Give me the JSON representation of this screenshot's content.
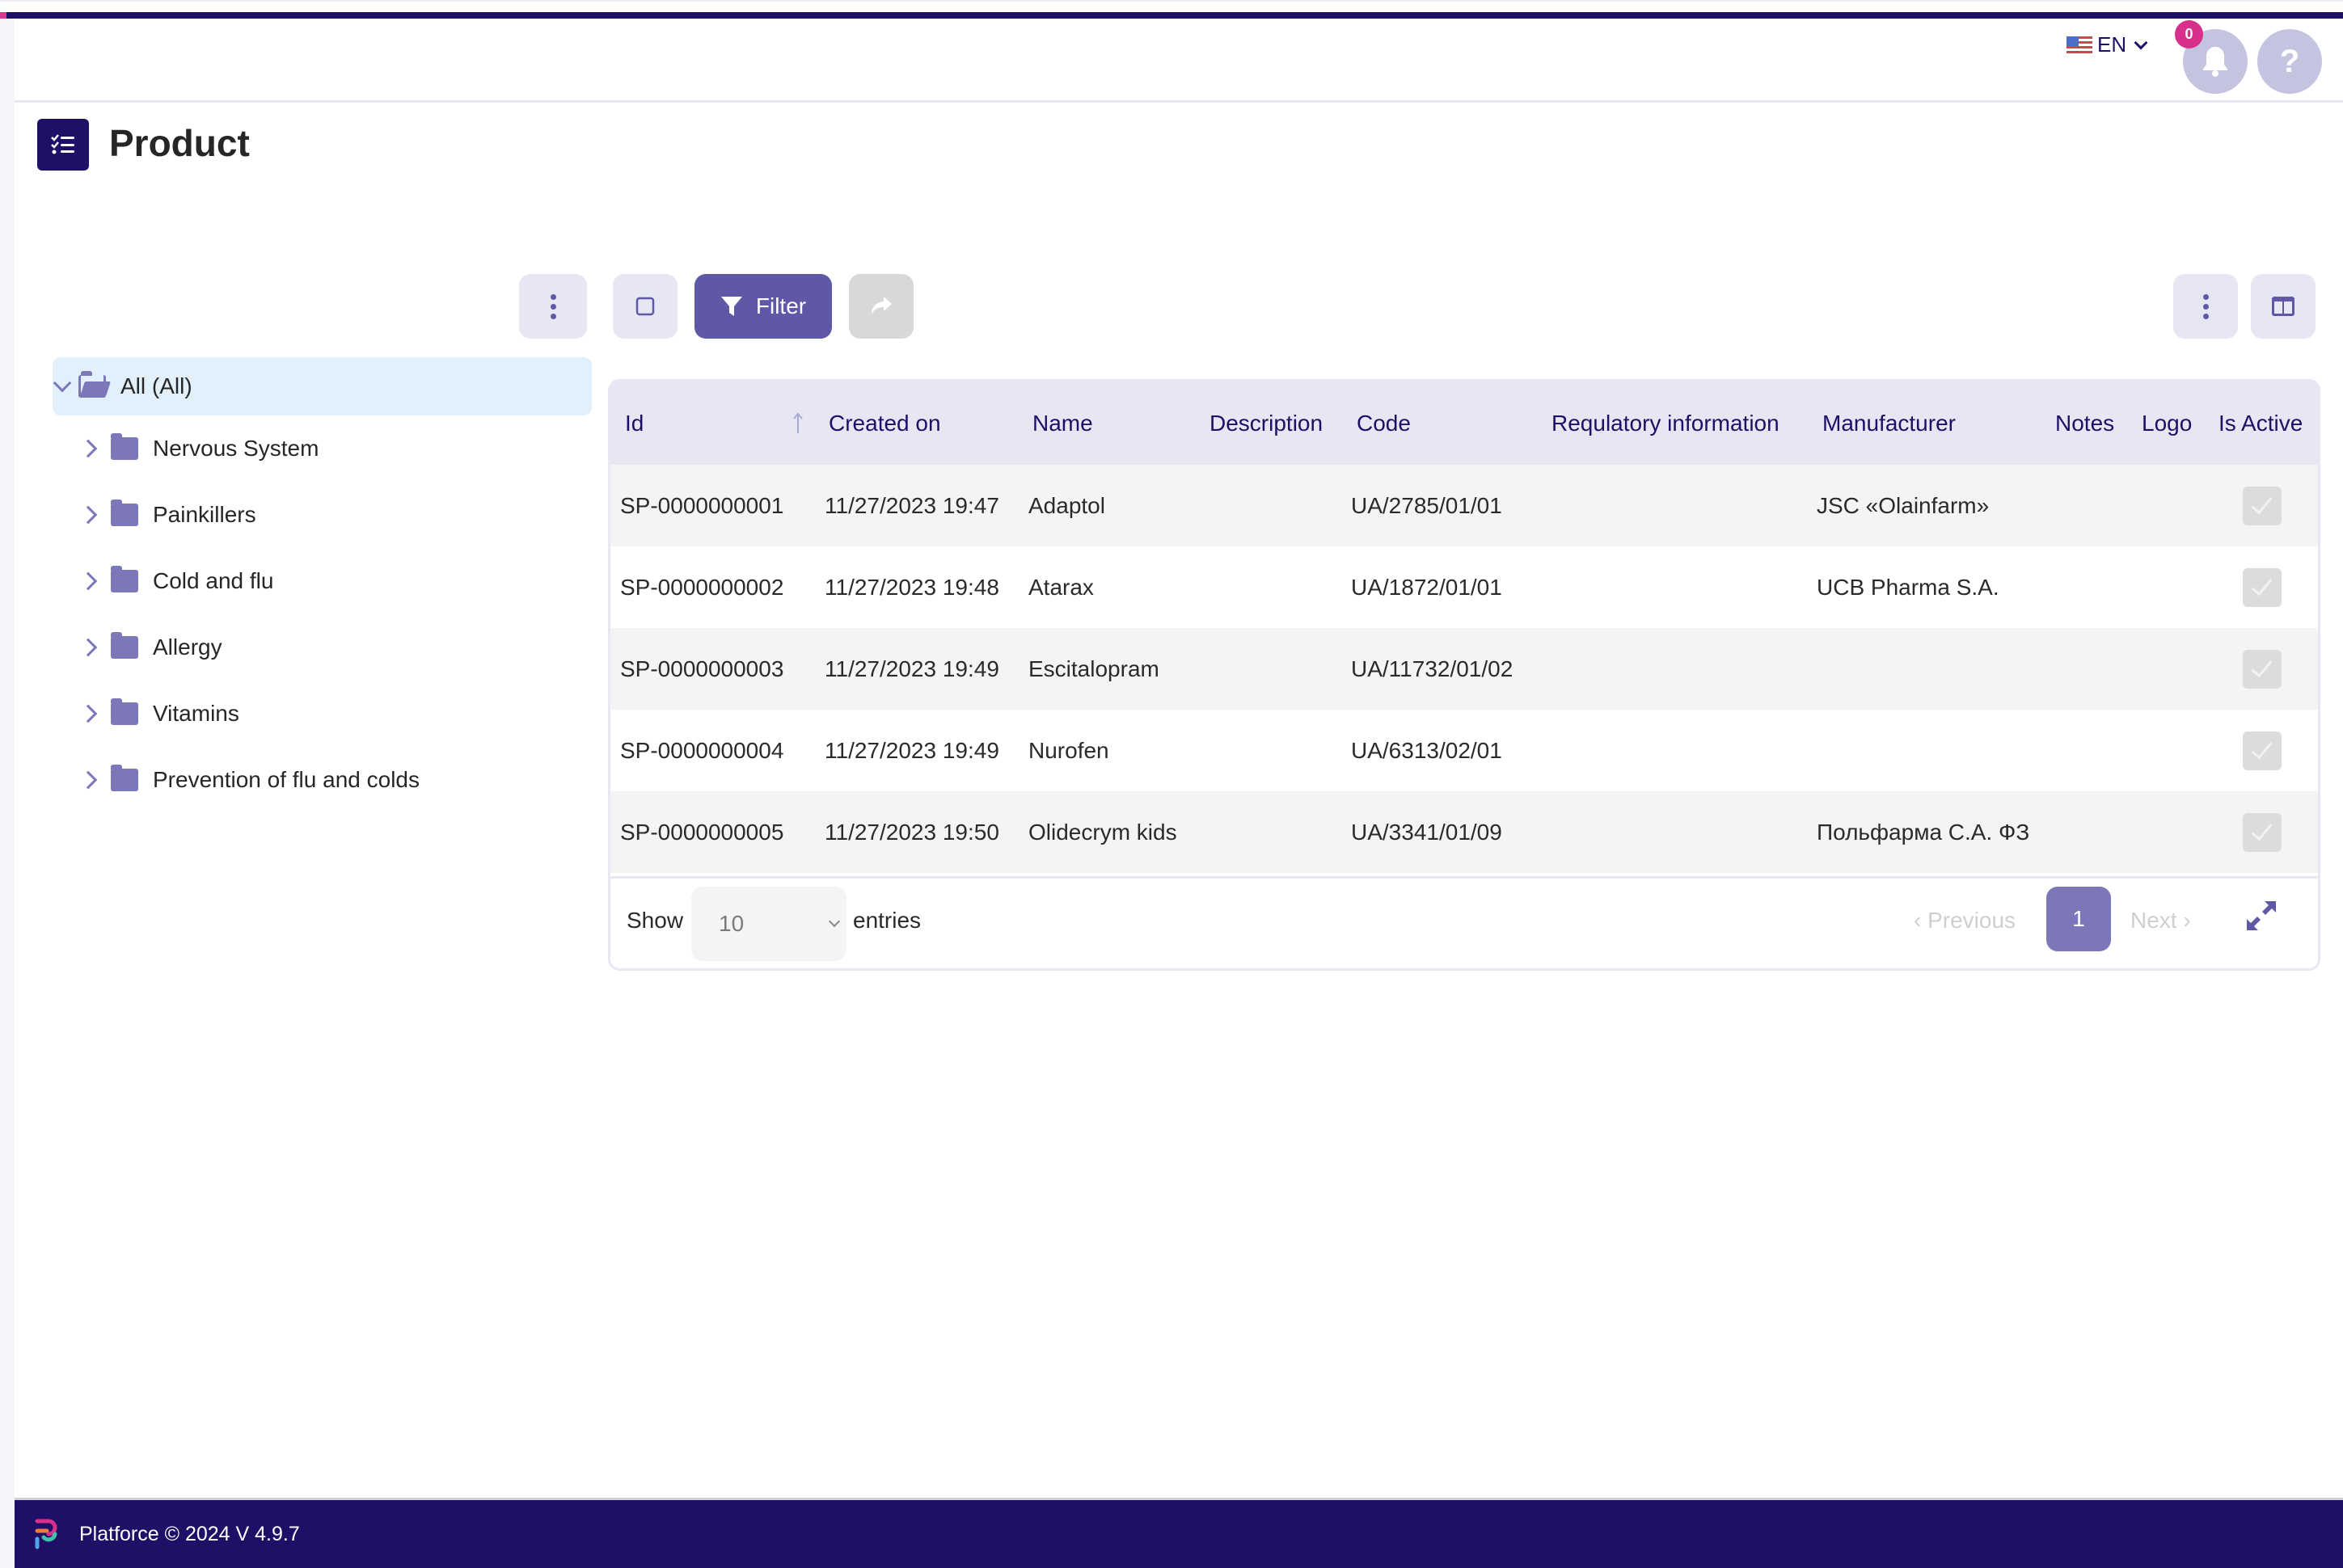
{
  "header": {
    "language": "EN",
    "flag_icon": "us-flag-icon",
    "notification_count": "0",
    "help_label": "?"
  },
  "page": {
    "title": "Product",
    "title_icon": "checklist-icon"
  },
  "toolbar": {
    "filter_label": "Filter",
    "icons": [
      "more-vertical-icon",
      "checkbox-icon",
      "filter-icon",
      "share-icon",
      "more-vertical-icon",
      "columns-icon"
    ]
  },
  "tree": {
    "root": "All (All)",
    "items": [
      {
        "label": "Nervous System"
      },
      {
        "label": "Painkillers"
      },
      {
        "label": "Cold and flu"
      },
      {
        "label": "Allergy"
      },
      {
        "label": "Vitamins"
      },
      {
        "label": "Prevention of flu and colds"
      }
    ]
  },
  "table": {
    "columns": [
      "Id",
      "Created on",
      "Name",
      "Description",
      "Code",
      "Requlatory information",
      "Manufacturer",
      "Notes",
      "Logo",
      "Is Active"
    ],
    "sort_column": "Id",
    "sort_direction": "ascending",
    "rows": [
      {
        "id": "SP-0000000001",
        "created": "11/27/2023 19:47",
        "name": "Adaptol",
        "description": "",
        "code": "UA/2785/01/01",
        "regulatory": "",
        "manufacturer": "JSC «Olainfarm»",
        "notes": "",
        "logo": "",
        "active": true
      },
      {
        "id": "SP-0000000002",
        "created": "11/27/2023 19:48",
        "name": "Atarax",
        "description": "",
        "code": "UA/1872/01/01",
        "regulatory": "",
        "manufacturer": "UCB Pharma S.A.",
        "notes": "",
        "logo": "",
        "active": true
      },
      {
        "id": "SP-0000000003",
        "created": "11/27/2023 19:49",
        "name": "Escitalopram",
        "description": "",
        "code": "UA/11732/01/02",
        "regulatory": "",
        "manufacturer": "",
        "notes": "",
        "logo": "",
        "active": true
      },
      {
        "id": "SP-0000000004",
        "created": "11/27/2023 19:49",
        "name": "Nurofen",
        "description": "",
        "code": "UA/6313/02/01",
        "regulatory": "",
        "manufacturer": "",
        "notes": "",
        "logo": "",
        "active": true
      },
      {
        "id": "SP-0000000005",
        "created": "11/27/2023 19:50",
        "name": "Olidecrym kids",
        "description": "",
        "code": "UA/3341/01/09",
        "regulatory": "",
        "manufacturer": "Польфарма С.А. ФЗ",
        "notes": "",
        "logo": "",
        "active": true
      }
    ]
  },
  "pagination": {
    "show_label": "Show",
    "page_size": "10",
    "entries_label": "entries",
    "previous_label": "Previous",
    "current_page": "1",
    "next_label": "Next"
  },
  "footer": {
    "text": "Platforce © 2024 V 4.9.7"
  },
  "colors": {
    "brand": "#1f0f66",
    "accent": "#5e58a6",
    "badge": "#d6308a",
    "tree_folder": "#7b77b8"
  }
}
